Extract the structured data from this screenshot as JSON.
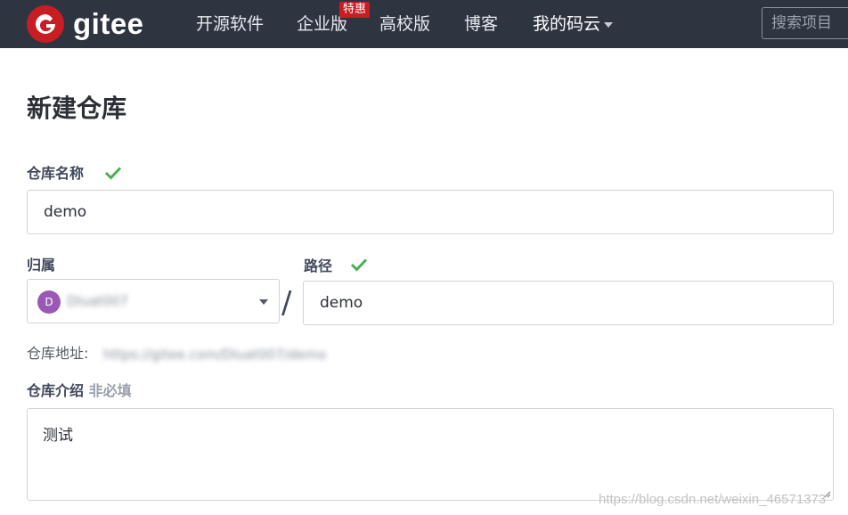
{
  "colors": {
    "nav_bg": "#2e3440",
    "brand_red": "#c71d23",
    "check_green": "#4caf50",
    "avatar_purple": "#9b59b6"
  },
  "nav": {
    "logo_text": "gitee",
    "logo_icon": "gitee-logo-icon",
    "items": [
      "开源软件",
      "企业版",
      "高校版",
      "博客"
    ],
    "badge": "特惠",
    "my_gitee": "我的码云",
    "search_placeholder": "搜索项目"
  },
  "form": {
    "title": "新建仓库",
    "repo_name_label": "仓库名称",
    "repo_name_value": "demo",
    "owner_label": "归属",
    "owner_avatar_letter": "D",
    "owner_name": "Dluat007",
    "separator": "/",
    "path_label": "路径",
    "path_value": "demo",
    "address_label": "仓库地址:",
    "address_value": "https://gitee.com/Dluat007/demo",
    "intro_label": "仓库介绍",
    "intro_optional": "非必填",
    "intro_value": "测试"
  },
  "watermark": "https://blog.csdn.net/weixin_46571373"
}
